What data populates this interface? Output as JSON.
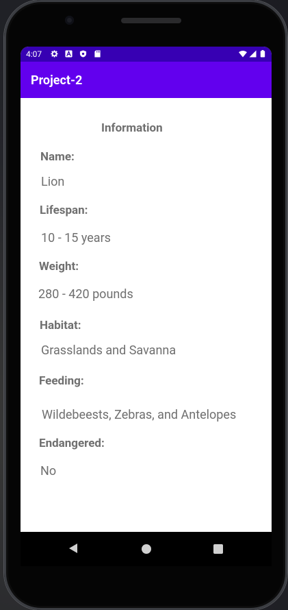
{
  "status_bar": {
    "time": "4:07",
    "icons_left": [
      "gear-icon",
      "a-icon",
      "shield-icon",
      "sd-card-icon"
    ],
    "icons_right": [
      "wifi-icon",
      "signal-icon",
      "battery-icon"
    ]
  },
  "app_bar": {
    "title": "Project-2"
  },
  "info": {
    "heading": "Information",
    "name_label": "Name:",
    "name_value": "Lion",
    "lifespan_label": "Lifespan:",
    "lifespan_value": "10 - 15 years",
    "weight_label": "Weight:",
    "weight_value": "280 - 420 pounds",
    "habitat_label": "Habitat:",
    "habitat_value": "Grasslands and Savanna",
    "feeding_label": "Feeding:",
    "feeding_value": "Wildebeests, Zebras, and Antelopes",
    "endangered_label": "Endangered:",
    "endangered_value": "No"
  },
  "nav": {
    "icons": [
      "back-icon",
      "home-icon",
      "recents-icon"
    ]
  },
  "colors": {
    "status_bar": "#3700b3",
    "app_bar": "#6200ee",
    "text": "#6f6f6f"
  }
}
